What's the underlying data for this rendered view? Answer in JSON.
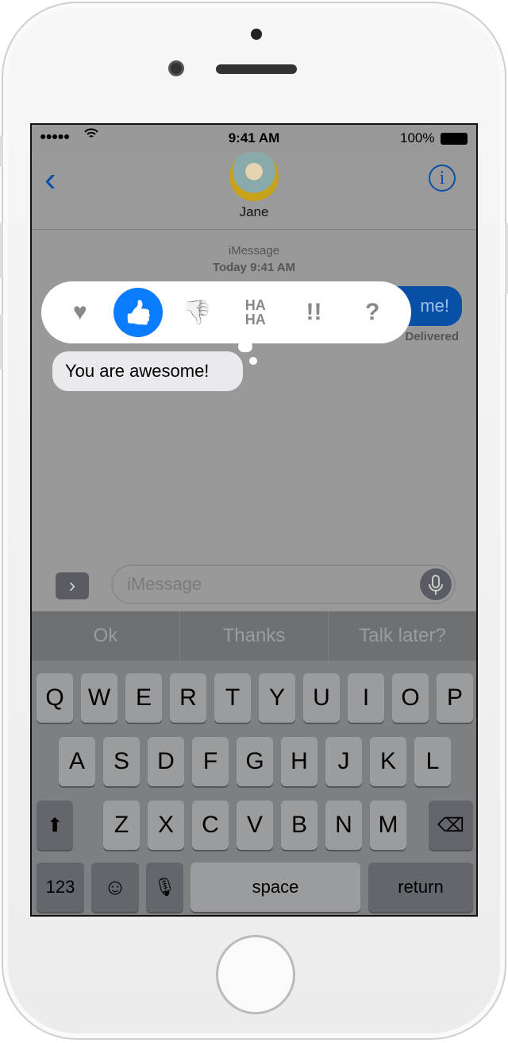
{
  "status": {
    "signal": "●●●●●",
    "time": "9:41 AM",
    "battery": "100%"
  },
  "nav": {
    "back_icon": "chevron-left",
    "contact_name": "Jane",
    "info_icon": "i"
  },
  "conversation": {
    "service": "iMessage",
    "timestamp": "Today 9:41 AM",
    "sent": {
      "text": "me!",
      "status": "Delivered"
    },
    "received": {
      "text": "You are awesome!"
    }
  },
  "tapbacks": [
    {
      "name": "heart",
      "glyph": "♥"
    },
    {
      "name": "thumbs-up",
      "glyph": "👍",
      "selected": true
    },
    {
      "name": "thumbs-down",
      "glyph": "👎"
    },
    {
      "name": "haha",
      "glyph": "HA HA"
    },
    {
      "name": "exclamation",
      "glyph": "!!"
    },
    {
      "name": "question",
      "glyph": "?"
    }
  ],
  "input": {
    "placeholder": "iMessage",
    "expand_icon": "›"
  },
  "suggestions": [
    "Ok",
    "Thanks",
    "Talk later?"
  ],
  "keyboard": {
    "row1": [
      "Q",
      "W",
      "E",
      "R",
      "T",
      "Y",
      "U",
      "I",
      "O",
      "P"
    ],
    "row2": [
      "A",
      "S",
      "D",
      "F",
      "G",
      "H",
      "J",
      "K",
      "L"
    ],
    "row3": [
      "Z",
      "X",
      "C",
      "V",
      "B",
      "N",
      "M"
    ],
    "numbers": "123",
    "space": "space",
    "return": "return"
  },
  "colors": {
    "accent": "#0a7cff",
    "sent_bubble": "#0a4fa6",
    "dim_bg": "#999999"
  }
}
